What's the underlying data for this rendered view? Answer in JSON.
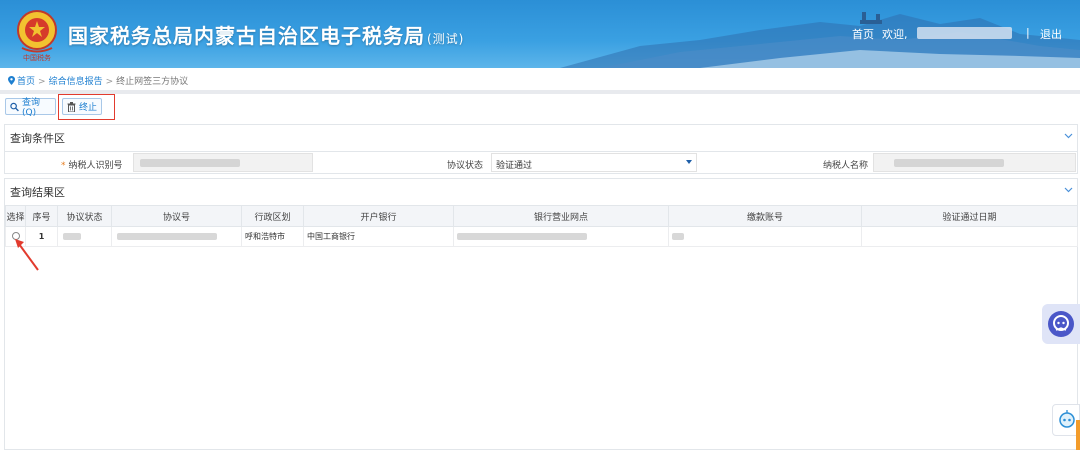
{
  "header": {
    "title": "国家税务总局内蒙古自治区电子税务局",
    "title_suffix": "(测试)",
    "home_link": "首页",
    "welcome": "欢迎,",
    "separator": "|",
    "logout": "退出",
    "emblem_caption": "中国税务",
    "colors": {
      "bar": "#3aa0e2",
      "mountains": "#2f6fae"
    }
  },
  "breadcrumb": {
    "home": "首页",
    "sep": ">",
    "level2": "综合信息报告",
    "current": "终止网签三方协议"
  },
  "toolbar": {
    "query_label": "查询(Q)",
    "stop_label": "终止"
  },
  "conditions": {
    "section_title": "查询条件区",
    "required_mark": "*",
    "taxpayer_id_label": "纳税人识别号",
    "status_label": "协议状态",
    "status_value": "验证通过",
    "taxpayer_name_label": "纳税人名称"
  },
  "results": {
    "section_title": "查询结果区",
    "columns": [
      "选择",
      "序号",
      "协议状态",
      "协议号",
      "行政区划",
      "开户银行",
      "银行营业网点",
      "缴款账号",
      "验证通过日期"
    ],
    "rows": [
      {
        "index": "1",
        "region": "呼和浩特市",
        "bank": "中国工商银行",
        "verify_date": ""
      }
    ]
  },
  "accent_color": "#1e7fd0",
  "highlight_color": "#e23b2e"
}
